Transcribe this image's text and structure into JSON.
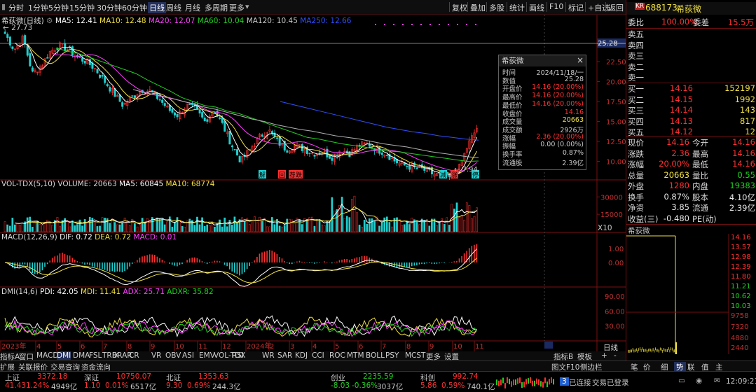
{
  "toolbar": {
    "periods": [
      "分时",
      "1分钟",
      "5分钟",
      "15分钟",
      "30分钟",
      "60分钟",
      "日线",
      "周线",
      "月线",
      "多周期",
      "更多"
    ],
    "active_period": "日线",
    "right_items": [
      "复权",
      "叠加",
      "多股",
      "统计",
      "画线",
      "F10",
      "标记",
      "+自选",
      "返回"
    ]
  },
  "quote": {
    "market_tag": "KR",
    "code": "688173",
    "name": "希荻微",
    "weibi_label": "委比",
    "weibi": "100.00%",
    "weicha_label": "委差",
    "weicha": "15.5万",
    "asks": [
      {
        "label": "卖五"
      },
      {
        "label": "卖四"
      },
      {
        "label": "卖三"
      },
      {
        "label": "卖二"
      },
      {
        "label": "卖一"
      }
    ],
    "bids": [
      {
        "label": "买一",
        "price": "14.16",
        "vol": "152197"
      },
      {
        "label": "买二",
        "price": "14.15",
        "vol": "1992"
      },
      {
        "label": "买三",
        "price": "14.14",
        "vol": "143"
      },
      {
        "label": "买四",
        "price": "14.13",
        "vol": "817"
      },
      {
        "label": "买五",
        "price": "14.12",
        "vol": "12"
      }
    ],
    "stats": [
      {
        "l1": "现价",
        "v1": "14.16",
        "l2": "今开",
        "v2": "14.16",
        "c1": "red",
        "c2": "red"
      },
      {
        "l1": "涨跌",
        "v1": "2.36",
        "l2": "最高",
        "v2": "14.16",
        "c1": "red",
        "c2": "red"
      },
      {
        "l1": "涨幅",
        "v1": "20.00%",
        "l2": "最低",
        "v2": "14.16",
        "c1": "red",
        "c2": "red"
      },
      {
        "l1": "总量",
        "v1": "20663",
        "l2": "量比",
        "v2": "0.55",
        "c1": "yel",
        "c2": "grn"
      },
      {
        "l1": "外盘",
        "v1": "1280",
        "l2": "内盘",
        "v2": "19383",
        "c1": "red",
        "c2": "grn"
      },
      {
        "l1": "换手",
        "v1": "0.87%",
        "l2": "股本",
        "v2": "4.10亿",
        "c1": "wht",
        "c2": "wht"
      },
      {
        "l1": "净资",
        "v1": "3.85",
        "l2": "流通",
        "v2": "2.39亿",
        "c1": "wht",
        "c2": "wht"
      },
      {
        "l1": "收益(三)",
        "v1": "-0.480",
        "l2": "PE(动)",
        "v2": "",
        "c1": "wht",
        "c2": "wht"
      }
    ],
    "mini_title": "希荻微",
    "mini_ticks": [
      "14.16",
      "13.57",
      "12.98",
      "12.39",
      "11.80",
      "11.21",
      "10.62",
      "10.03",
      "9758",
      "7320",
      "4880",
      "2440"
    ]
  },
  "panels": {
    "main": {
      "title": "希荻微(日线)",
      "ma5": "MA5: 12.41",
      "ma10": "MA10: 12.48",
      "ma20": "MA20: 12.07",
      "ma60": "MA60: 10.04",
      "ma120": "MA120: 10.45",
      "ma250": "MA250: 12.66",
      "high_label": "27.73",
      "low_label": "7.94",
      "price_tag": "25.28",
      "markers": [
        "解",
        "回",
        "荐",
        "跌"
      ],
      "markers2": [
        "减",
        "涨",
        "停"
      ]
    },
    "vol": {
      "title": "VOL-TDX(5,10)",
      "v": "VOLUME: 20663",
      "ma5": "MA5: 60845",
      "ma10": "MA10: 68774",
      "unit": "X10"
    },
    "macd": {
      "title": "MACD(12,26,9)",
      "dif": "DIF: 0.72",
      "dea": "DEA: 0.72",
      "macd": "MACD: 0.01"
    },
    "dmi": {
      "title": "DMI(14,6)",
      "pdi": "PDI: 42.05",
      "mdi": "MDI: 11.41",
      "adx": "ADX: 25.71",
      "adxr": "ADXR: 35.82"
    }
  },
  "axis": {
    "main": [
      "25.00",
      "22.50",
      "20.00",
      "17.50",
      "15.00",
      "12.50",
      "10.00"
    ],
    "vol": [
      "30000",
      "15000"
    ],
    "macd": [
      "1.00",
      "0.00"
    ],
    "dmi": [
      "90.00",
      "60.00",
      "30.00"
    ],
    "period": "日线",
    "x_labels": [
      "2023年",
      "4",
      "5",
      "6",
      "7",
      "8",
      "9",
      "10",
      "11",
      "12",
      "2024年",
      "2",
      "3",
      "4",
      "5",
      "6",
      "7",
      "8",
      "9",
      "10",
      "11"
    ]
  },
  "tooltip": {
    "title": "希荻微",
    "rows": [
      {
        "k": "时间",
        "v": "2024/11/18/一",
        "c": "#c8c8c8"
      },
      {
        "k": "数值",
        "v": "25.28",
        "c": "#c8c8c8"
      },
      {
        "k": "开盘价",
        "v": "14.16 (20.00%)",
        "c": "#ff3030"
      },
      {
        "k": "最高价",
        "v": "14.16 (20.00%)",
        "c": "#ff3030"
      },
      {
        "k": "最低价",
        "v": "14.16 (20.00%)",
        "c": "#ff3030"
      },
      {
        "k": "收盘价",
        "v": "14.16",
        "c": "#ff3030"
      },
      {
        "k": "成交量",
        "v": "20663",
        "c": "#f0e040"
      },
      {
        "k": "成交额",
        "v": "2926万",
        "c": "#c8c8c8"
      },
      {
        "k": "涨幅",
        "v": "2.36 (20.00%)",
        "c": "#ff3030"
      },
      {
        "k": "振幅",
        "v": "0.00 (0.00%)",
        "c": "#c8c8c8"
      },
      {
        "k": "换手率",
        "v": "0.87%",
        "c": "#c8c8c8"
      },
      {
        "k": "流通股",
        "v": "2.39亿",
        "c": "#c8c8c8"
      }
    ]
  },
  "bottom_tabs": [
    "指标A",
    "窗口",
    "MACD",
    "DMI",
    "DMA",
    "FSL",
    "TRIX",
    "BRAR",
    "CR",
    "VR",
    "OBV",
    "ASI",
    "EMV",
    "VOL-TDX",
    "RSI",
    "WR",
    "SAR",
    "KDJ",
    "CCI",
    "ROC",
    "MTM",
    "BOLL",
    "PSY",
    "MCST",
    "更多",
    "设置"
  ],
  "bottom_right": [
    "指标B",
    "模板"
  ],
  "tab2": [
    "扩展",
    "关联报价",
    "交易查询",
    "资金流向"
  ],
  "tab2_right": [
    "图文F10",
    "侧边栏"
  ],
  "right_tabs": [
    "笔",
    "价",
    "细",
    "势",
    "联",
    "值",
    "主"
  ],
  "status": {
    "idx": [
      {
        "name": "上证",
        "p": "3372.18",
        "chg": "41.43",
        "pct": "1.24%",
        "amt": "4949亿"
      },
      {
        "name": "深证",
        "p": "10750.07",
        "chg": "1.10",
        "pct": "0.01%",
        "amt": "6517亿"
      },
      {
        "name": "北证",
        "p": "1353.63",
        "chg": "9.30",
        "pct": "0.69%",
        "amt": "244.3亿"
      },
      {
        "name": "创业",
        "p": "2235.59",
        "chg": "-8.03",
        "pct": "-0.36%",
        "amt": "3037亿"
      },
      {
        "name": "科创",
        "p": "992.74",
        "chg": "5.86",
        "pct": "0.59%",
        "amt": "740.1亿"
      }
    ],
    "badge": "3",
    "connected": "已连接",
    "login": "交易已登录",
    "time": "12:09:21"
  },
  "colors": {
    "up": "#ff3030",
    "down": "#20d020",
    "ma5": "#ffffff",
    "ma10": "#f0e040",
    "ma20": "#ff40ff",
    "ma60": "#20d020",
    "ma120": "#a0a0a0",
    "ma250": "#3050ff"
  },
  "chart_data": {
    "type": "candlestick",
    "title": "希荻微(日线)",
    "ylim": [
      7.5,
      27.5
    ],
    "x_months": [
      "2023年",
      "4",
      "5",
      "6",
      "7",
      "8",
      "9",
      "10",
      "11",
      "12",
      "2024年",
      "2",
      "3",
      "4",
      "5",
      "6",
      "7",
      "8",
      "9",
      "10",
      "11"
    ],
    "close_path": [
      26,
      24,
      25.5,
      21,
      22,
      23.8,
      24.5,
      24,
      23,
      22.5,
      21.5,
      20,
      18.5,
      17,
      18,
      19,
      18.8,
      17.8,
      16.5,
      15.8,
      17,
      16.5,
      15,
      16.5,
      14.5,
      12,
      10,
      11.5,
      13,
      14,
      12.5,
      11.5,
      12,
      11.5,
      11,
      11.2,
      10.5,
      11.5,
      11,
      12,
      12.2,
      11.5,
      11,
      10,
      9.5,
      9.2,
      9,
      8.5,
      8.2,
      7.94,
      9,
      12,
      14.16
    ],
    "ma60_path": [
      24.2,
      23.8,
      23.5,
      23,
      22.5,
      22,
      21.5,
      21,
      20.2,
      19.5,
      18.8,
      18,
      17.5,
      17,
      16.8,
      16.3,
      16,
      15.5,
      15,
      14.5,
      14,
      13.5,
      13,
      12.8,
      12.5,
      12.2,
      12,
      11.8,
      11.5,
      11.3,
      11.2,
      11,
      10.8,
      10.6,
      10.4,
      10.2,
      10,
      10.04
    ],
    "ma120_path": [
      19,
      18.6,
      18.3,
      18,
      17.6,
      17.2,
      16.8,
      16.5,
      16.1,
      15.7,
      15.3,
      15,
      14.6,
      14.3,
      14,
      13.8,
      13.5,
      13.2,
      13,
      12.8,
      12.5,
      12.2,
      12,
      11.8,
      11.5,
      11.2,
      11,
      10.8,
      10.6,
      10.45
    ],
    "ma250_path": [
      17.5,
      17.1,
      16.7,
      16.3,
      15.9,
      15.5,
      15.1,
      14.7,
      14.3,
      14,
      13.7,
      13.5,
      13.2,
      13,
      12.8,
      12.66
    ],
    "series": [
      {
        "name": "MA5",
        "last": 12.41
      },
      {
        "name": "MA10",
        "last": 12.48
      },
      {
        "name": "MA20",
        "last": 12.07
      },
      {
        "name": "MA60",
        "last": 10.04
      },
      {
        "name": "MA120",
        "last": 10.45
      },
      {
        "name": "MA250",
        "last": 12.66
      }
    ],
    "volume": {
      "last": 20663,
      "ma5": 60845,
      "ma10": 68774,
      "ylim": [
        0,
        35000
      ]
    },
    "macd": {
      "dif": 0.72,
      "dea": 0.72,
      "macd": 0.01
    },
    "dmi": {
      "pdi": 42.05,
      "mdi": 11.41,
      "adx": 25.71,
      "adxr": 35.82
    }
  }
}
